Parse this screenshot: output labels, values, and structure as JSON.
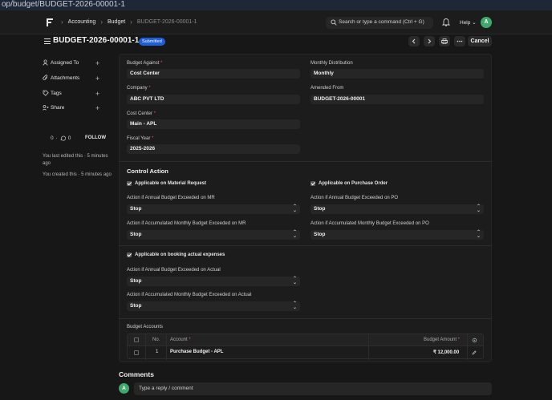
{
  "browser": {
    "url": "op/budget/BUDGET-2026-00001-1"
  },
  "navbar": {
    "breadcrumbs": [
      "Accounting",
      "Budget",
      "BUDGET-2026-00001-1"
    ],
    "search_placeholder": "Search or type a command (Ctrl + G)",
    "help_label": "Help",
    "avatar_initial": "A"
  },
  "header": {
    "title": "BUDGET-2026-00001-1",
    "status": "Submitted",
    "cancel_label": "Cancel"
  },
  "sidebar": {
    "items": [
      {
        "label": "Assigned To",
        "icon": "assign-icon"
      },
      {
        "label": "Attachments",
        "icon": "paperclip-icon"
      },
      {
        "label": "Tags",
        "icon": "tag-icon"
      },
      {
        "label": "Share",
        "icon": "share-icon"
      }
    ],
    "likes": "0",
    "comments_count": "0",
    "follow_label": "FOLLOW",
    "edited_text": "You last edited this · 5 minutes ago",
    "created_text": "You created this · 5 minutes ago"
  },
  "form": {
    "budget_against": {
      "label": "Budget Against",
      "value": "Cost Center"
    },
    "company": {
      "label": "Company",
      "value": "ABC PVT LTD"
    },
    "cost_center": {
      "label": "Cost Center",
      "value": "Main - APL"
    },
    "fiscal_year": {
      "label": "Fiscal Year",
      "value": "2025-2026"
    },
    "monthly_distribution": {
      "label": "Monthly Distribution",
      "value": "Monthly"
    },
    "amended_from": {
      "label": "Amended From",
      "value": "BUDGET-2026-00001"
    }
  },
  "control_action": {
    "title": "Control Action",
    "material_request": {
      "label": "Applicable on Material Request",
      "annual_label": "Action if Annual Budget Exceeded on MR",
      "annual_value": "Stop",
      "monthly_label": "Action if Accumulated Monthly Budget Exceeded on MR",
      "monthly_value": "Stop"
    },
    "purchase_order": {
      "label": "Applicable on Purchase Order",
      "annual_label": "Action if Annual Budget Exceeded on PO",
      "annual_value": "Stop",
      "monthly_label": "Action if Accumulated Monthly Budget Exceeded on PO",
      "monthly_value": "Stop"
    },
    "actual_expenses": {
      "label": "Applicable on booking actual expenses",
      "annual_label": "Action if Annual Budget Exceeded on Actual",
      "annual_value": "Stop",
      "monthly_label": "Action if Accumulated Monthly Budget Exceeded on Actual",
      "monthly_value": "Stop"
    }
  },
  "budget_accounts": {
    "label": "Budget Accounts",
    "columns": {
      "no": "No.",
      "account": "Account",
      "amount": "Budget Amount"
    },
    "rows": [
      {
        "no": "1",
        "account": "Purchase Budget - APL",
        "amount": "₹ 12,000.00"
      }
    ]
  },
  "comments": {
    "title": "Comments",
    "placeholder": "Type a reply / comment",
    "avatar_initial": "A"
  },
  "colors": {
    "accent": "#1f5ed8",
    "avatar": "#3fa86a",
    "required": "#e05252"
  }
}
